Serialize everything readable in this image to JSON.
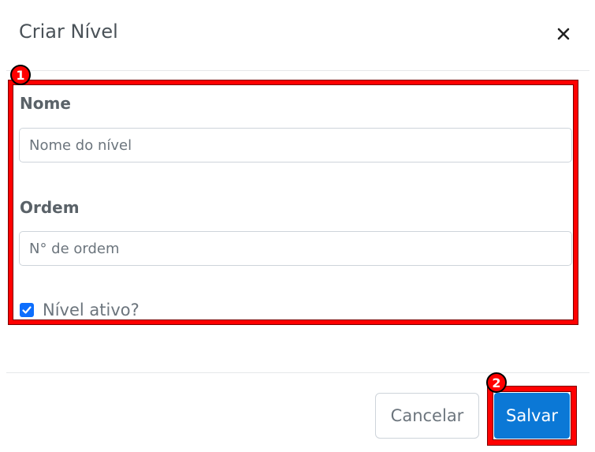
{
  "modal": {
    "title": "Criar Nível",
    "close_icon": "close-icon"
  },
  "form": {
    "name_label": "Nome",
    "name_placeholder": "Nome do nível",
    "name_value": "",
    "order_label": "Ordem",
    "order_placeholder": "N° de ordem",
    "order_value": "",
    "active_label": "Nível ativo?",
    "active_checked": true
  },
  "footer": {
    "cancel_label": "Cancelar",
    "save_label": "Salvar"
  },
  "annotations": {
    "step1": "1",
    "step2": "2",
    "highlight_color": "#ff0000"
  },
  "colors": {
    "primary": "#0b78d6",
    "checkbox": "#0d6efd"
  }
}
